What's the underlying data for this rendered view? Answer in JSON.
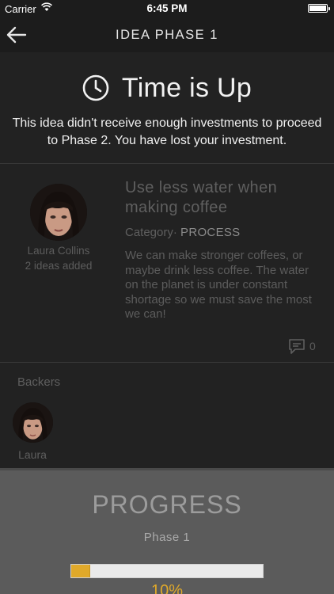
{
  "status_bar": {
    "carrier": "Carrier",
    "time": "6:45 PM"
  },
  "nav": {
    "title": "IDEA PHASE 1",
    "back_icon": "back-arrow-icon"
  },
  "timeup": {
    "icon": "clock-icon",
    "title": "Time is Up",
    "message": "This idea didn't receive enough investments to proceed to Phase 2. You have lost your investment."
  },
  "idea": {
    "author_name": "Laura Collins",
    "author_ideas": "2 ideas added",
    "title": "Use less water when making coffee",
    "category_label": "Category·",
    "category_value": "PROCESS",
    "description": "We can make stronger coffees, or maybe drink less coffee. The water on the planet is under constant shortage so we must save the most we can!",
    "comments_icon": "comment-bubble-icon",
    "comments_count": "0"
  },
  "backers": {
    "label": "Backers",
    "items": [
      {
        "name": "Laura"
      }
    ]
  },
  "progress": {
    "title": "PROGRESS",
    "phase": "Phase 1",
    "percent_label": "10%",
    "fraction": 0.1
  },
  "colors": {
    "background": "#222222",
    "bar": "#1c1c1c",
    "panel": "#5b5b5b",
    "accent": "#e0a92a"
  }
}
